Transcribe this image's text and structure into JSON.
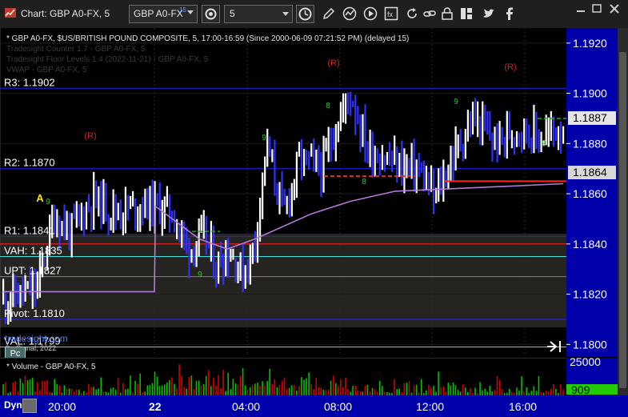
{
  "window": {
    "title": "Chart: GBP A0-FX, 5",
    "symbol": "GBP A0-FX",
    "symbol_sup": "15",
    "interval": "5"
  },
  "price_panel": {
    "header": "* GBP A0-FX, $US/BRITISH POUND COMPOSITE, 5, 17:00-16:59 (Since 2000-06-09 07:21:52 PM) (delayed 15)",
    "study1": "Tradesight Counter 1.7 - GBP A0-FX, 5",
    "study2": "Tradesight Floor Levels 1.4 (2022-11-21) - GBP A0-FX, 5",
    "study3": "VWAP - GBP A0-FX, 5",
    "watermark": "tradesight.com",
    "copyright": "© eSignal, 2022",
    "pc_button": "Pc"
  },
  "levels": [
    {
      "label": "R3: 1.1902",
      "price": 1.1902,
      "color": "#2020ff"
    },
    {
      "label": "R2: 1.1870",
      "price": 1.187,
      "color": "#2020ff"
    },
    {
      "label": "R1: 1.1841",
      "price": 1.1843,
      "color": "#2020ff"
    },
    {
      "label": "VAH: 1.1835",
      "price": 1.1835,
      "color": "#40e0e0"
    },
    {
      "label": "UPT: 1.1827",
      "price": 1.1827,
      "color": "#808080"
    },
    {
      "label": "Pivot: 1.1810",
      "price": 1.181,
      "color": "#2020ff"
    },
    {
      "label": "VAL: 1.1799",
      "price": 1.1799,
      "color": "#40e0e0"
    }
  ],
  "markers": {
    "r_label": "(R)",
    "a_label": "A",
    "counter_labels": [
      "9",
      "9",
      "9",
      "8",
      "8",
      "9",
      "9"
    ]
  },
  "volume_panel": {
    "header": "* Volume - GBP A0-FX, 5",
    "scale_label": "25000",
    "last_value": "909"
  },
  "colors": {
    "up_bar": "#ffffff",
    "down_bar": "#3030ff",
    "vwap": "#b07ad8",
    "support_red": "#ff2020",
    "last_price_bg": "#e6e6e6",
    "support_label_bg": "#d7d7d7",
    "vol_up": "#00c000",
    "vol_down": "#d00000",
    "vol_last_bg": "#22cc00"
  },
  "chart_data": {
    "type": "bar",
    "title": "GBP A0-FX, 5",
    "y_axis_ticks": [
      "1.1920",
      "1.1900",
      "1.1880",
      "1.1860",
      "1.1840",
      "1.1820",
      "1.1800"
    ],
    "ylim": [
      1.1795,
      1.1926
    ],
    "x_ticks": [
      "20:00",
      "22",
      "04:00",
      "08:00",
      "12:00",
      "16:00"
    ],
    "last_price": "1.1887",
    "support_price": "1.1864",
    "close_path": [
      [
        0,
        1.1818
      ],
      [
        0.06,
        1.1822
      ],
      [
        0.09,
        1.1851
      ],
      [
        0.12,
        1.1845
      ],
      [
        0.16,
        1.1858
      ],
      [
        0.2,
        1.1853
      ],
      [
        0.26,
        1.1856
      ],
      [
        0.3,
        1.1853
      ],
      [
        0.33,
        1.1838
      ],
      [
        0.36,
        1.1843
      ],
      [
        0.38,
        1.1831
      ],
      [
        0.4,
        1.1838
      ],
      [
        0.43,
        1.1828
      ],
      [
        0.45,
        1.1842
      ],
      [
        0.47,
        1.188
      ],
      [
        0.5,
        1.1852
      ],
      [
        0.53,
        1.1874
      ],
      [
        0.57,
        1.187
      ],
      [
        0.59,
        1.1885
      ],
      [
        0.62,
        1.19
      ],
      [
        0.65,
        1.1878
      ],
      [
        0.7,
        1.1872
      ],
      [
        0.74,
        1.187
      ],
      [
        0.77,
        1.1858
      ],
      [
        0.81,
        1.1878
      ],
      [
        0.84,
        1.189
      ],
      [
        0.88,
        1.188
      ],
      [
        0.92,
        1.1887
      ],
      [
        0.96,
        1.1882
      ],
      [
        1.0,
        1.1887
      ]
    ],
    "vwap_path": [
      [
        0,
        1.1821
      ],
      [
        0.27,
        1.1821
      ],
      [
        0.272,
        1.1855
      ],
      [
        0.35,
        1.1842
      ],
      [
        0.4,
        1.1838
      ],
      [
        0.45,
        1.1842
      ],
      [
        0.55,
        1.1852
      ],
      [
        0.62,
        1.1857
      ],
      [
        0.7,
        1.1861
      ],
      [
        0.8,
        1.1862
      ],
      [
        0.9,
        1.1863
      ],
      [
        1.0,
        1.1864
      ]
    ]
  }
}
